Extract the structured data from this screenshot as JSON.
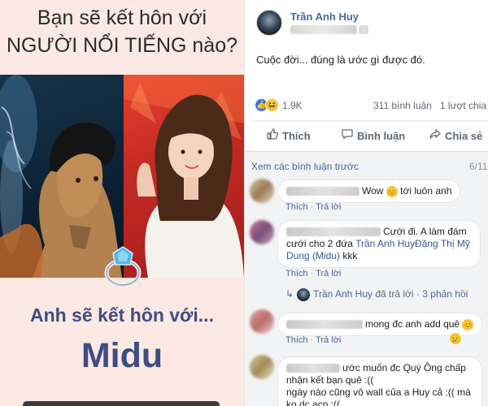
{
  "quiz": {
    "question_line1": "Bạn sẽ kết hôn với",
    "question_line2": "NGƯỜI NỔI TIẾNG nào?",
    "answer_line1": "Anh sẽ kết hôn với...",
    "answer_name": "Midu",
    "ring_icon": "ring-icon",
    "colors": {
      "background": "#fde9e4",
      "answer_text": "#3f4e82"
    }
  },
  "post": {
    "author": "Trần Anh Huy",
    "text": "Cuộc đời... đúng là ước gì được đó.",
    "reactions": {
      "icons": [
        "like-icon",
        "haha-icon"
      ],
      "count": "1,9K"
    },
    "comments_count": "311 bình luận",
    "shares": "1 lượt chia sẻ",
    "actions": [
      {
        "label": "Thích",
        "icon": "thumbs-up-icon"
      },
      {
        "label": "Bình luận",
        "icon": "comment-icon"
      },
      {
        "label": "Chia sẻ",
        "icon": "share-icon"
      }
    ],
    "view_previous": "Xem các bình luận trước",
    "visible_count": "6/11",
    "colors": {
      "link": "#4b67a1",
      "meta": "#606770"
    }
  },
  "comments": [
    {
      "text": "Wow",
      "text_after": "tới luôn anh",
      "like_label": "Thích",
      "reply_label": "Trả lời",
      "separator": "·"
    },
    {
      "text_line1": "Cưới đi. A làm đám",
      "text_line2": "cưới cho 2 đứa",
      "mention1": "Trần Anh Huy",
      "mention2_line2": "Đặng Thị Mỹ",
      "mention2_line3": "Dung (Midu)",
      "text_after": "kkk",
      "like_label": "Thích",
      "reply_label": "Trả lời",
      "separator": "·",
      "reply_author": "Trần Anh Huy",
      "reply_text": "đã trả lời",
      "reply_count": "3 phản hồi"
    },
    {
      "text": "mong đc anh add quê",
      "like_label": "Thích",
      "reply_label": "Trả lời",
      "separator": "·"
    },
    {
      "text_line1": "ước muốn đc Quý Ông chấp",
      "text_line2": "nhận kết bạn quê :((",
      "text_line3": "ngày nào cũng vô wall của a Huy cả :(( mà",
      "text_line4": "ko dc acp :(("
    }
  ]
}
